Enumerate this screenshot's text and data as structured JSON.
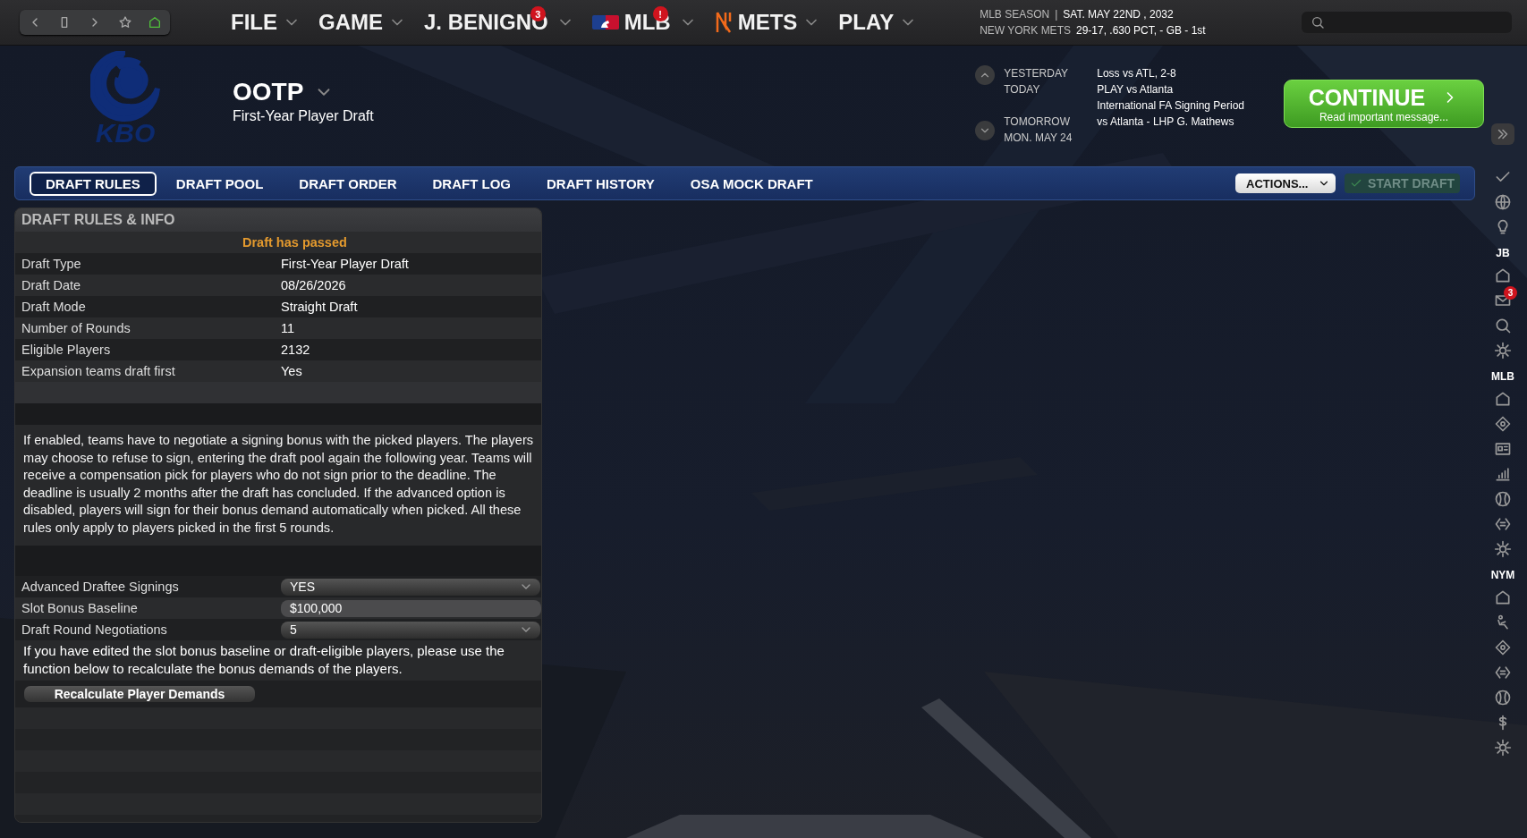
{
  "top_bar": {
    "menus": [
      {
        "label": "FILE",
        "kind": "plain"
      },
      {
        "label": "GAME",
        "kind": "plain"
      },
      {
        "label": "J. BENIGNO",
        "kind": "plain",
        "badge": "3"
      },
      {
        "label": "MLB",
        "kind": "league",
        "badge": "!"
      },
      {
        "label": "METS",
        "kind": "team"
      },
      {
        "label": "PLAY",
        "kind": "plain"
      }
    ],
    "status": [
      {
        "label": "MLB SEASON",
        "separator": "|",
        "value": "SAT. MAY 22ND , 2032"
      },
      {
        "label": "NEW YORK METS",
        "value": "29-17, .630 PCT, - GB - 1st"
      }
    ]
  },
  "header": {
    "logo_text": "KBO",
    "title": "OOTP",
    "subtitle": "First-Year Player Draft",
    "schedule": [
      {
        "day": "YESTERDAY",
        "event": "Loss vs ATL, 2-8"
      },
      {
        "day": "TODAY",
        "event": "PLAY vs Atlanta"
      },
      {
        "event": "International FA Signing Period"
      },
      {
        "day": "TOMORROW",
        "event": "vs Atlanta - LHP G. Mathews"
      },
      {
        "day": "MON. MAY 24"
      }
    ],
    "continue": {
      "label": "CONTINUE",
      "message": "Read important message..."
    }
  },
  "tabs": [
    {
      "label": "DRAFT RULES",
      "selected": true
    },
    {
      "label": "DRAFT POOL",
      "selected": false
    },
    {
      "label": "DRAFT ORDER",
      "selected": false
    },
    {
      "label": "DRAFT LOG",
      "selected": false
    },
    {
      "label": "DRAFT HISTORY",
      "selected": false
    },
    {
      "label": "OSA MOCK DRAFT",
      "selected": false
    }
  ],
  "actions": {
    "label": "ACTIONS..."
  },
  "start_draft": {
    "label": "START DRAFT",
    "disabled": true
  },
  "panel": {
    "title": "DRAFT RULES & INFO",
    "notice": "Draft has passed",
    "rows": [
      {
        "label": "Draft Type",
        "value": "First-Year Player Draft"
      },
      {
        "label": "Draft Date",
        "value": "08/26/2026"
      },
      {
        "label": "Draft Mode",
        "value": "Straight Draft"
      },
      {
        "label": "Number of Rounds",
        "value": "11"
      },
      {
        "label": "Eligible Players",
        "value": "2132"
      },
      {
        "label": "Expansion teams draft first",
        "value": "Yes"
      }
    ],
    "description": "If enabled, teams have to negotiate a signing bonus with the picked players. The players may choose to refuse to sign, entering the draft pool again the following year. Teams will receive a compensation pick for players who do not sign prior to the deadline. The deadline is usually 2 months after the draft has concluded. If the advanced option is disabled, players will sign for their bonus demand automatically when picked. All these rules only apply to players picked in the first 5 rounds.",
    "settings": [
      {
        "label": "Advanced Draftee Signings",
        "kind": "select",
        "value": "YES"
      },
      {
        "label": "Slot Bonus Baseline",
        "kind": "input",
        "value": "$100,000"
      },
      {
        "label": "Draft Round Negotiations",
        "kind": "select",
        "value": "5"
      }
    ],
    "note": "If you have edited the slot bonus baseline or draft-eligible players, please use the function below to recalculate the bonus demands of the players.",
    "button": "Recalculate Player Demands"
  },
  "sidebar": {
    "groups": [
      {
        "label": "JB",
        "badge": "3"
      },
      {
        "label": "MLB"
      },
      {
        "label": "NYM"
      }
    ]
  }
}
